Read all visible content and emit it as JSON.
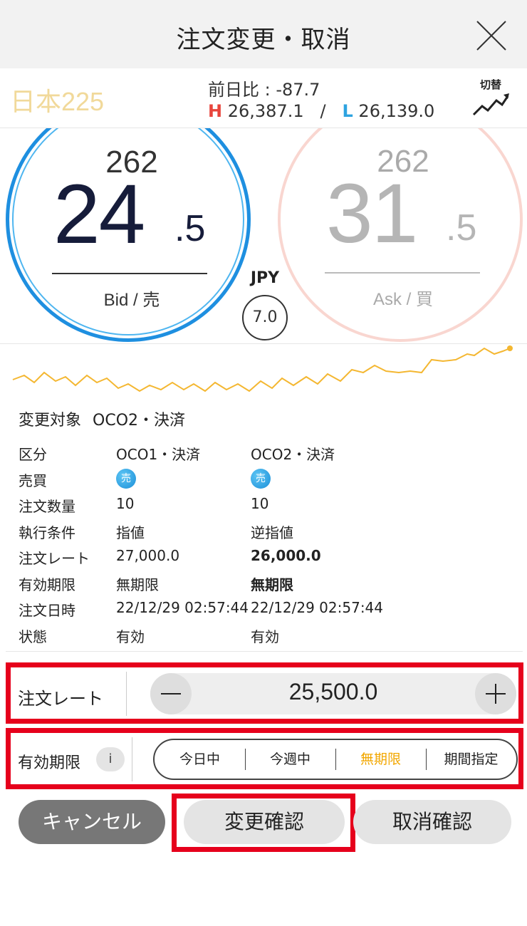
{
  "header": {
    "title": "注文変更・取消"
  },
  "market": {
    "symbol": "日本225",
    "prev_diff": "前日比 : -87.7",
    "high_marker": "H",
    "high": "26,387.1",
    "separator": "/",
    "low_marker": "L",
    "low": "26,139.0",
    "switch_label": "切替"
  },
  "bid": {
    "prefix": "262",
    "main": "24",
    "frac": ".5",
    "label": "Bid / 売"
  },
  "ask": {
    "prefix": "262",
    "main": "31",
    "frac": ".5",
    "label": "Ask / 買"
  },
  "currency": "JPY",
  "spread": "7.0",
  "colors": {
    "accent": "#f2a700",
    "bid": "#1e8fe0",
    "ask": "#f9d6d0",
    "highlight": "#e6001c",
    "high": "#e8453c",
    "low": "#2ea3e0"
  },
  "target": {
    "label": "変更対象",
    "value": "OCO2・決済"
  },
  "details": {
    "rows": [
      {
        "label": "区分",
        "oco1": "OCO1・決済",
        "oco2": "OCO2・決済"
      },
      {
        "label": "売買",
        "oco1": "売",
        "oco2": "売"
      },
      {
        "label": "注文数量",
        "oco1": "10",
        "oco2": "10"
      },
      {
        "label": "執行条件",
        "oco1": "指値",
        "oco2": "逆指値"
      },
      {
        "label": "注文レート",
        "oco1": "27,000.0",
        "oco2": "26,000.0"
      },
      {
        "label": "有効期限",
        "oco1": "無期限",
        "oco2": "無期限"
      },
      {
        "label": "注文日時",
        "oco1": "22/12/29 02:57:44",
        "oco2": "22/12/29 02:57:44"
      },
      {
        "label": "状態",
        "oco1": "有効",
        "oco2": "有効"
      }
    ]
  },
  "order_rate": {
    "label": "注文レート",
    "value": "25,500.0"
  },
  "expiry": {
    "label": "有効期限",
    "info": "i",
    "options": [
      "今日中",
      "今週中",
      "無期限",
      "期間指定"
    ],
    "selected": "無期限"
  },
  "buttons": {
    "cancel": "キャンセル",
    "confirm_change": "変更確認",
    "confirm_cancel": "取消確認"
  }
}
